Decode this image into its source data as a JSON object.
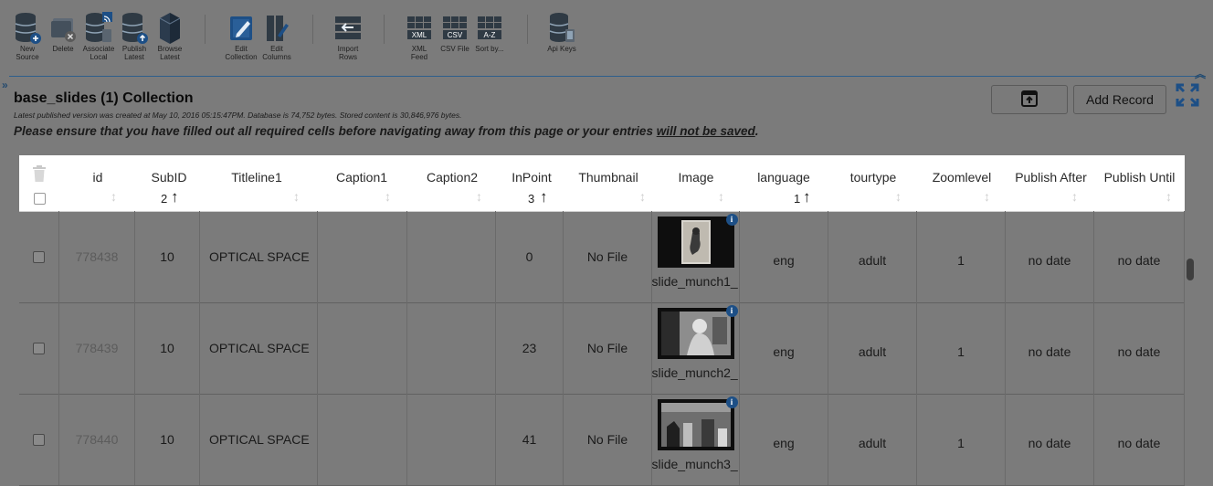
{
  "toolbar": {
    "items": [
      {
        "label": "New\nSource",
        "icon": "database-add-icon"
      },
      {
        "label": "Delete",
        "icon": "delete-source-icon"
      },
      {
        "label": "Associate\nLocal",
        "icon": "associate-local-icon"
      },
      {
        "label": "Publish\nLatest",
        "icon": "publish-latest-icon"
      },
      {
        "label": "Browse\nLatest",
        "icon": "browse-latest-icon"
      },
      {
        "label": "Edit\nCollection",
        "icon": "edit-collection-icon"
      },
      {
        "label": "Edit\nColumns",
        "icon": "edit-columns-icon"
      },
      {
        "label": "Import\nRows",
        "icon": "import-rows-icon"
      },
      {
        "label": "XML\nFeed",
        "icon": "xml-feed-icon"
      },
      {
        "label": "CSV File",
        "icon": "csv-file-icon"
      },
      {
        "label": "Sort by...",
        "icon": "sort-az-icon"
      },
      {
        "label": "Api Keys",
        "icon": "api-keys-icon"
      }
    ]
  },
  "collection": {
    "title": "base_slides (1) Collection",
    "info": "Latest published version was created at May 10, 2016 05:15:47PM. Database is 74,752 bytes. Stored content is 30,846,976 bytes.",
    "warning_prefix": "Please ensure that you have filled out all required cells before navigating away from this page or your entries ",
    "warning_emph": "will not be saved",
    "warning_suffix": "."
  },
  "actions": {
    "add_record": "Add Record"
  },
  "table": {
    "columns": [
      {
        "name": "",
        "key": "select"
      },
      {
        "name": "id",
        "key": "id"
      },
      {
        "name": "SubID",
        "key": "subid",
        "sort": "2"
      },
      {
        "name": "Titleline1",
        "key": "titleline1"
      },
      {
        "name": "Caption1",
        "key": "caption1"
      },
      {
        "name": "Caption2",
        "key": "caption2"
      },
      {
        "name": "InPoint",
        "key": "inpoint",
        "sort": "3"
      },
      {
        "name": "Thumbnail",
        "key": "thumbnail"
      },
      {
        "name": "Image",
        "key": "image"
      },
      {
        "name": "language",
        "key": "language",
        "sort": "1"
      },
      {
        "name": "tourtype",
        "key": "tourtype"
      },
      {
        "name": "Zoomlevel",
        "key": "zoomlevel"
      },
      {
        "name": "Publish After",
        "key": "publish_after"
      },
      {
        "name": "Publish Until",
        "key": "publish_until"
      }
    ],
    "rows": [
      {
        "id": "778438",
        "subid": "10",
        "titleline1": "OPTICAL SPACE",
        "caption1": "",
        "caption2": "",
        "inpoint": "0",
        "thumbnail": "No File",
        "image": "slide_munch1_",
        "language": "eng",
        "tourtype": "adult",
        "zoomlevel": "1",
        "publish_after": "no date",
        "publish_until": "no date"
      },
      {
        "id": "778439",
        "subid": "10",
        "titleline1": "OPTICAL SPACE",
        "caption1": "",
        "caption2": "",
        "inpoint": "23",
        "thumbnail": "No File",
        "image": "slide_munch2_",
        "language": "eng",
        "tourtype": "adult",
        "zoomlevel": "1",
        "publish_after": "no date",
        "publish_until": "no date"
      },
      {
        "id": "778440",
        "subid": "10",
        "titleline1": "OPTICAL SPACE",
        "caption1": "",
        "caption2": "",
        "inpoint": "41",
        "thumbnail": "No File",
        "image": "slide_munch3_",
        "language": "eng",
        "tourtype": "adult",
        "zoomlevel": "1",
        "publish_after": "no date",
        "publish_until": "no date"
      }
    ]
  }
}
